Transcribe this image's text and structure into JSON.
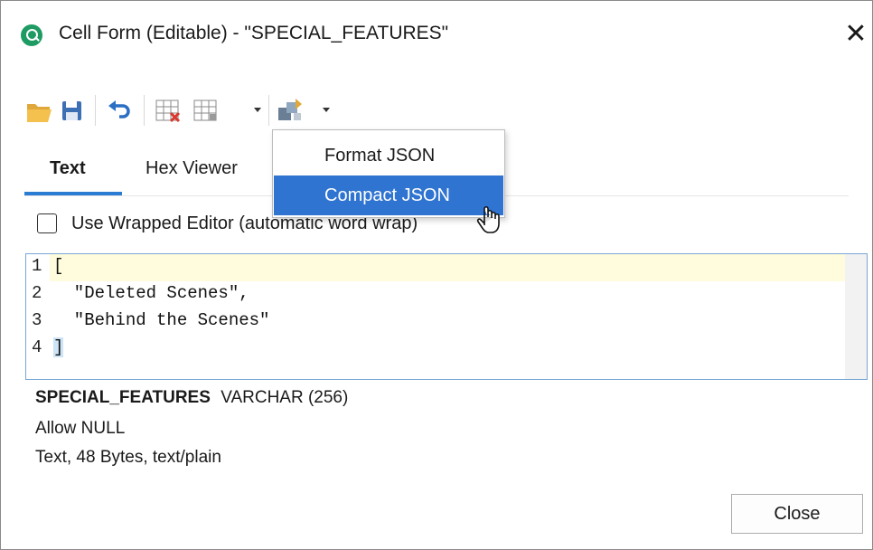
{
  "window": {
    "title": "Cell Form (Editable) - \"SPECIAL_FEATURES\"",
    "close_glyph": "✕"
  },
  "toolbar": {
    "icons": [
      "folder-open-icon",
      "save-icon",
      "undo-icon",
      "null-cell-icon",
      "grid-icon",
      "format-icon"
    ]
  },
  "tabs": [
    {
      "label": "Text",
      "active": true
    },
    {
      "label": "Hex Viewer",
      "active": false
    }
  ],
  "wrap_option": {
    "label": "Use Wrapped Editor (automatic word wrap)",
    "checked": false
  },
  "editor": {
    "lines": [
      {
        "num": "1",
        "text": "["
      },
      {
        "num": "2",
        "text": "  \"Deleted Scenes\","
      },
      {
        "num": "3",
        "text": "  \"Behind the Scenes\""
      },
      {
        "num": "4",
        "text": "]"
      }
    ]
  },
  "info": {
    "column_name": "SPECIAL_FEATURES",
    "column_type": "VARCHAR (256)",
    "nullability": "Allow NULL",
    "details": "Text, 48 Bytes, text/plain"
  },
  "buttons": {
    "close": "Close"
  },
  "format_menu": {
    "items": [
      {
        "label": "Format JSON",
        "highlighted": false
      },
      {
        "label": "Compact JSON",
        "highlighted": true
      }
    ]
  },
  "colors": {
    "accent": "#2b7cd3",
    "menu_highlight": "#2f74d0",
    "current_line": "#fefcdc",
    "app_icon": "#1e9b62"
  }
}
